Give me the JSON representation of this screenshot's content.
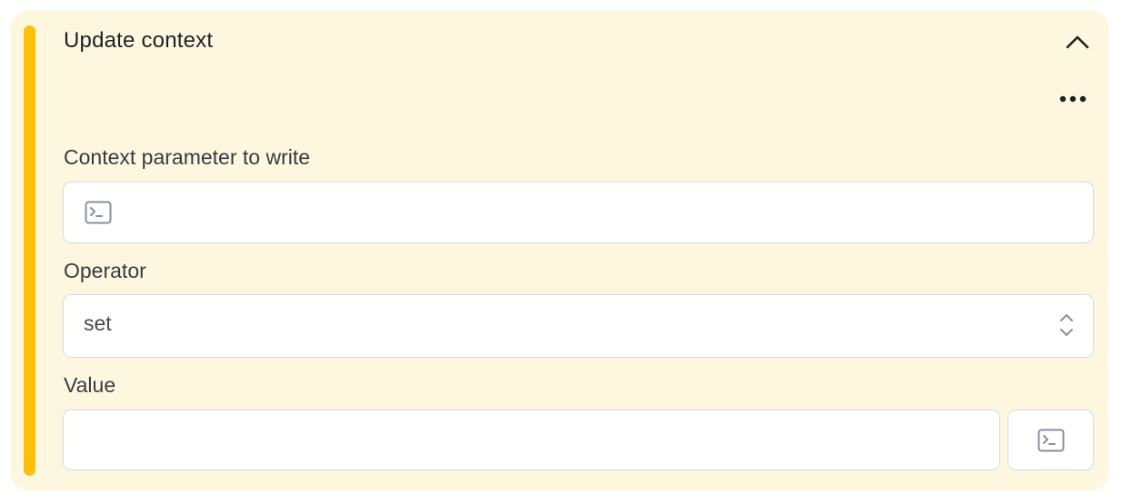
{
  "block": {
    "title": "Update context",
    "collapse_icon": "chevron-up-icon",
    "more_icon": "more-horizontal-icon",
    "accent_color": "#fbbf0e",
    "background_color": "#fdf7e0"
  },
  "fields": {
    "context_param": {
      "label": "Context parameter to write",
      "value": "",
      "icon": "terminal-icon"
    },
    "operator": {
      "label": "Operator",
      "selected": "set",
      "icon": "chevron-up-down-icon"
    },
    "value": {
      "label": "Value",
      "value": "",
      "button_icon": "terminal-icon"
    }
  }
}
